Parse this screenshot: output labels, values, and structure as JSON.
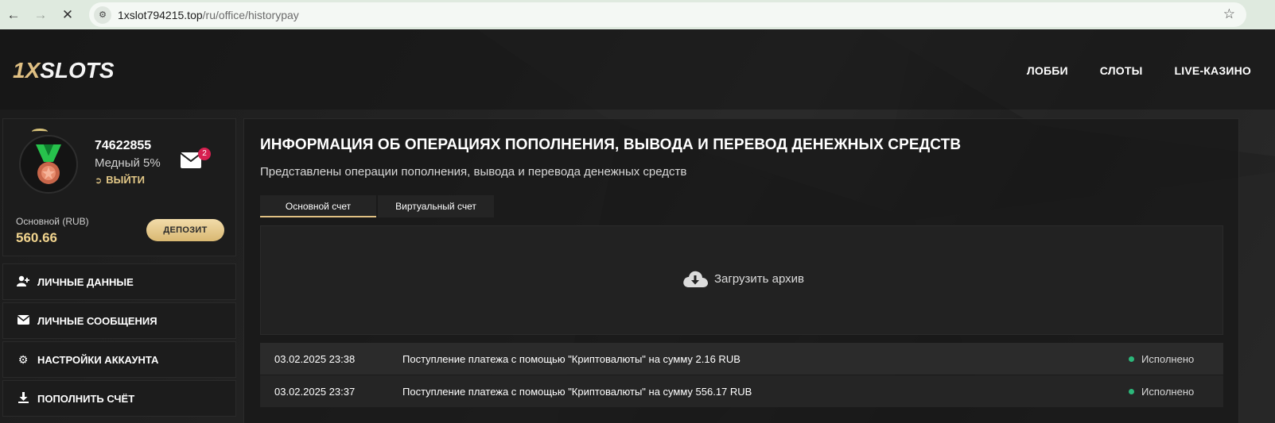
{
  "browser": {
    "url_host": "1xslot794215.top",
    "url_path": "/ru/office/historypay"
  },
  "header": {
    "logo_prefix": "1X",
    "logo_suffix": "SLOTS",
    "nav": [
      "ЛОББИ",
      "СЛОТЫ",
      "LIVE-КАЗИНО"
    ]
  },
  "profile": {
    "user_id": "74622855",
    "rank": "Медный 5%",
    "logout_label": "ВЫЙТИ",
    "unread_messages": "2",
    "account_label": "Основной (RUB)",
    "balance": "560.66",
    "deposit_label": "ДЕПОЗИТ"
  },
  "menu": [
    {
      "label": "ЛИЧНЫЕ ДАННЫЕ",
      "icon": "user-plus-icon"
    },
    {
      "label": "ЛИЧНЫЕ СООБЩЕНИЯ",
      "icon": "envelope-icon"
    },
    {
      "label": "НАСТРОЙКИ АККАУНТА",
      "icon": "cogs-icon"
    },
    {
      "label": "ПОПОЛНИТЬ СЧЁТ",
      "icon": "download-icon"
    }
  ],
  "main": {
    "title": "ИНФОРМАЦИЯ ОБ ОПЕРАЦИЯХ ПОПОЛНЕНИЯ, ВЫВОДА И ПЕРЕВОД ДЕНЕЖНЫХ СРЕДСТВ",
    "subtitle": "Представлены операции пополнения, вывода и перевода денежных средств",
    "tabs": [
      {
        "label": "Основной счет",
        "active": true
      },
      {
        "label": "Виртуальный счет",
        "active": false
      }
    ],
    "archive_label": "Загрузить архив",
    "transactions": [
      {
        "datetime": "03.02.2025 23:38",
        "description": "Поступление платежа с помощью \"Криптовалюты\" на сумму 2.16 RUB",
        "status": "Исполнено"
      },
      {
        "datetime": "03.02.2025 23:37",
        "description": "Поступление платежа с помощью \"Криптовалюты\" на сумму 556.17 RUB",
        "status": "Исполнено"
      }
    ]
  },
  "colors": {
    "accent_gold": "#e0c083",
    "status_success": "#2cb77a",
    "badge_red": "#d62050"
  }
}
